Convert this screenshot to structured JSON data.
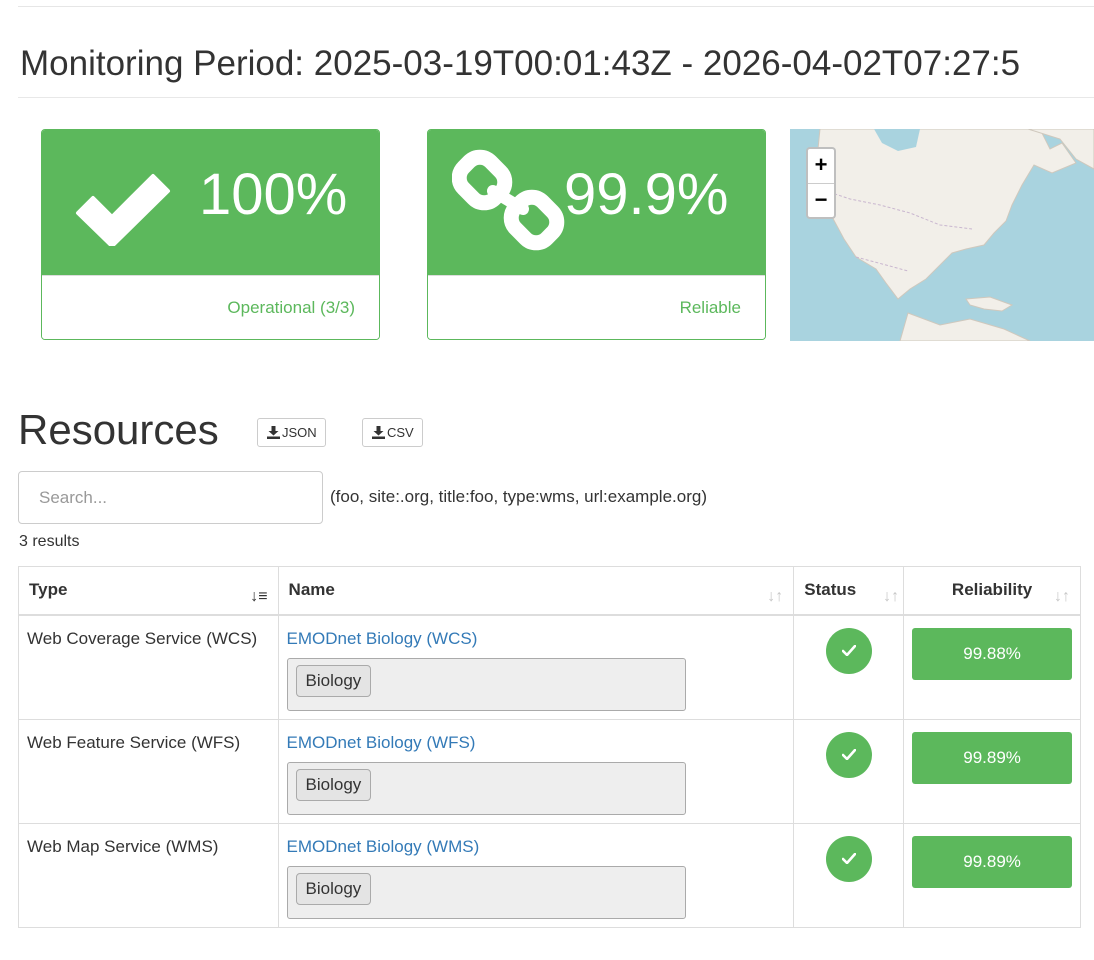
{
  "monitoring": {
    "period_text": "Monitoring Period: 2025-03-19T00:01:43Z - 2026-04-02T07:27:5"
  },
  "summary": {
    "operational": {
      "value": "100%",
      "label": "Operational (3/3)",
      "icon": "checkmark-icon"
    },
    "reliability": {
      "value": "99.9%",
      "label": "Reliable",
      "icon": "chain-link-icon"
    }
  },
  "map": {
    "zoom_in": "+",
    "zoom_out": "−"
  },
  "resources": {
    "title": "Resources",
    "json_label": "JSON",
    "csv_label": "CSV",
    "search_placeholder": "Search...",
    "search_hint": "(foo, site:.org, title:foo, type:wms, url:example.org)",
    "results_count": "3 results",
    "columns": {
      "type": "Type",
      "name": "Name",
      "status": "Status",
      "reliability": "Reliability"
    },
    "rows": [
      {
        "type": "Web Coverage Service (WCS)",
        "name": "EMODnet Biology (WCS)",
        "tag": "Biology",
        "status": "ok",
        "reliability": "99.88%"
      },
      {
        "type": "Web Feature Service (WFS)",
        "name": "EMODnet Biology (WFS)",
        "tag": "Biology",
        "status": "ok",
        "reliability": "99.89%"
      },
      {
        "type": "Web Map Service (WMS)",
        "name": "EMODnet Biology (WMS)",
        "tag": "Biology",
        "status": "ok",
        "reliability": "99.89%"
      }
    ]
  },
  "colors": {
    "success": "#5cb85c",
    "link": "#337ab7",
    "map_water": "#a9d3df",
    "map_land": "#f2efe9"
  }
}
